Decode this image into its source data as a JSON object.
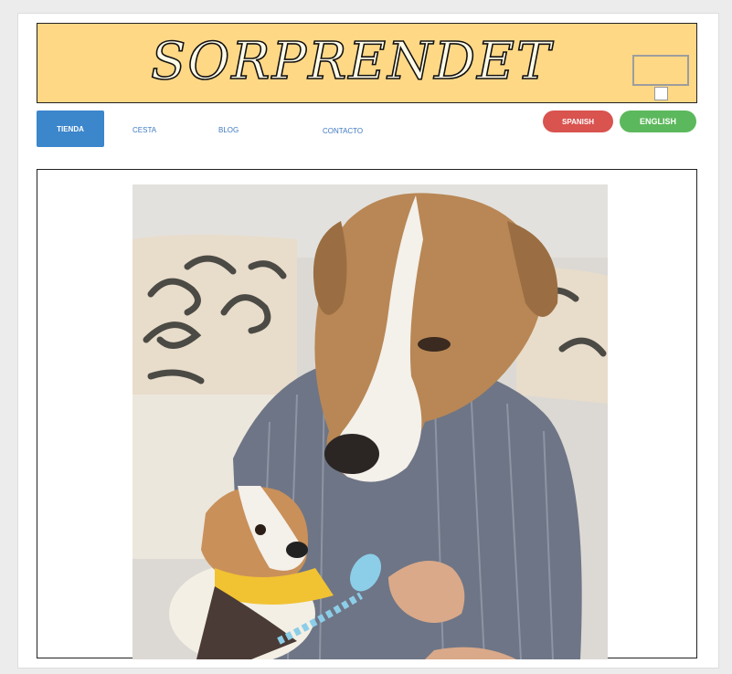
{
  "header": {
    "logo_text": "SORPRENDET",
    "bg_color": "#ffd886"
  },
  "nav": {
    "items": [
      {
        "label": "TIENDA",
        "active": true
      },
      {
        "label": "CESTA",
        "active": false
      },
      {
        "label": "BLOG",
        "active": false
      },
      {
        "label": "CONTACTO",
        "active": false
      }
    ],
    "active_color": "#3c86cc",
    "link_color": "#3f79c1"
  },
  "languages": {
    "spanish_label": "SPANISH",
    "english_label": "ENGLISH",
    "spanish_color": "#d9534f",
    "english_color": "#5cb85c"
  },
  "main": {
    "image_icon": "photo-icon"
  }
}
